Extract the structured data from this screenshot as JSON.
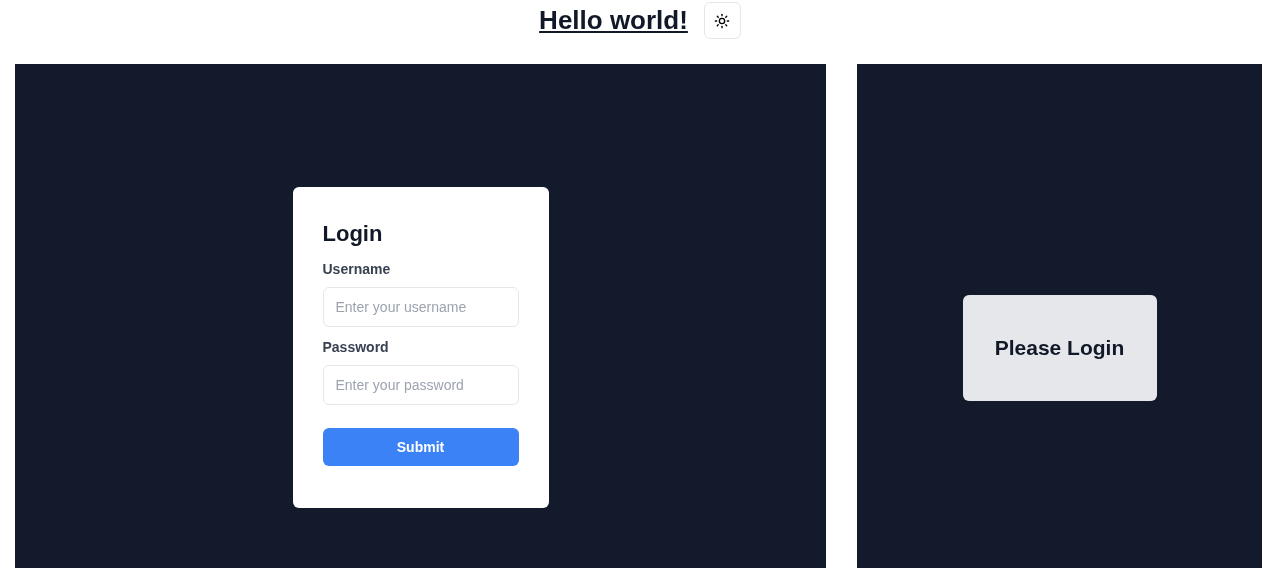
{
  "header": {
    "title": "Hello world!"
  },
  "login_form": {
    "title": "Login",
    "fields": [
      {
        "label": "Username",
        "placeholder": "Enter your username"
      },
      {
        "label": "Password",
        "placeholder": "Enter your password"
      }
    ],
    "submit": "Submit"
  },
  "status_panel": {
    "message": "Please Login"
  }
}
